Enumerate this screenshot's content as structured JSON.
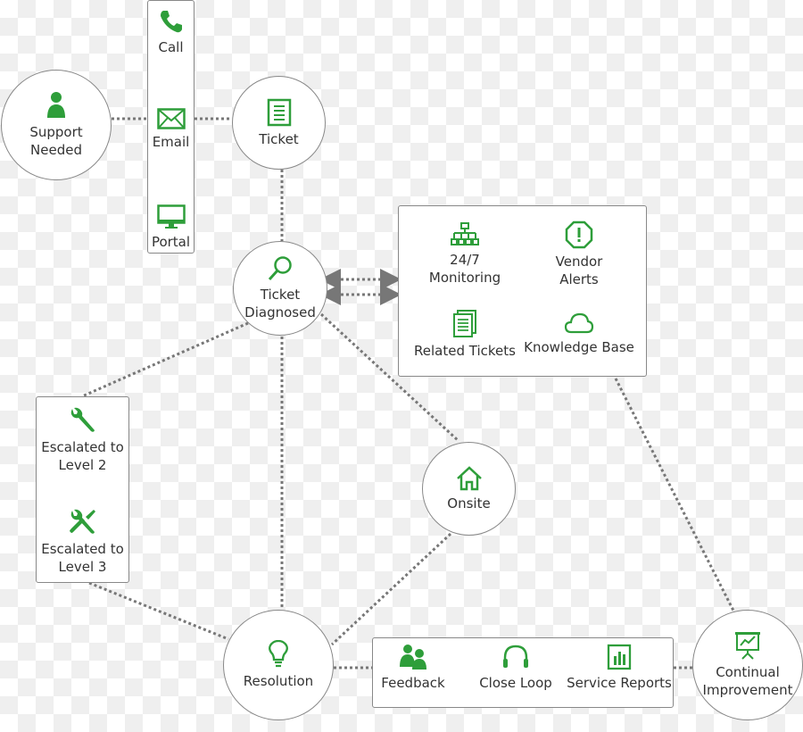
{
  "accent_color": "#2e9e3a",
  "line_color": "#777777",
  "nodes": {
    "support_needed": {
      "label": "Support\nNeeded",
      "icon": "person-icon"
    },
    "ticket": {
      "label": "Ticket",
      "icon": "document-icon"
    },
    "ticket_diagnosed": {
      "label": "Ticket\nDiagnosed",
      "icon": "magnifier-icon"
    },
    "onsite": {
      "label": "Onsite",
      "icon": "house-icon"
    },
    "resolution": {
      "label": "Resolution",
      "icon": "lightbulb-icon"
    },
    "continual_improvement": {
      "label": "Continual\nImprovement",
      "icon": "presentation-chart-icon"
    }
  },
  "channels": [
    {
      "label": "Call",
      "icon": "phone-icon"
    },
    {
      "label": "Email",
      "icon": "envelope-icon"
    },
    {
      "label": "Portal",
      "icon": "monitor-icon"
    }
  ],
  "resources": [
    {
      "label": "24/7\nMonitoring",
      "icon": "hierarchy-icon"
    },
    {
      "label": "Vendor\nAlerts",
      "icon": "alert-octagon-icon"
    },
    {
      "label": "Related Tickets",
      "icon": "documents-icon"
    },
    {
      "label": "Knowledge Base",
      "icon": "cloud-icon"
    }
  ],
  "escalations": [
    {
      "label": "Escalated to\nLevel 2",
      "icon": "wrench-icon"
    },
    {
      "label": "Escalated to\nLevel 3",
      "icon": "tools-icon"
    }
  ],
  "followups": [
    {
      "label": "Feedback",
      "icon": "users-icon"
    },
    {
      "label": "Close Loop",
      "icon": "headphones-icon"
    },
    {
      "label": "Service Reports",
      "icon": "bar-report-icon"
    }
  ]
}
